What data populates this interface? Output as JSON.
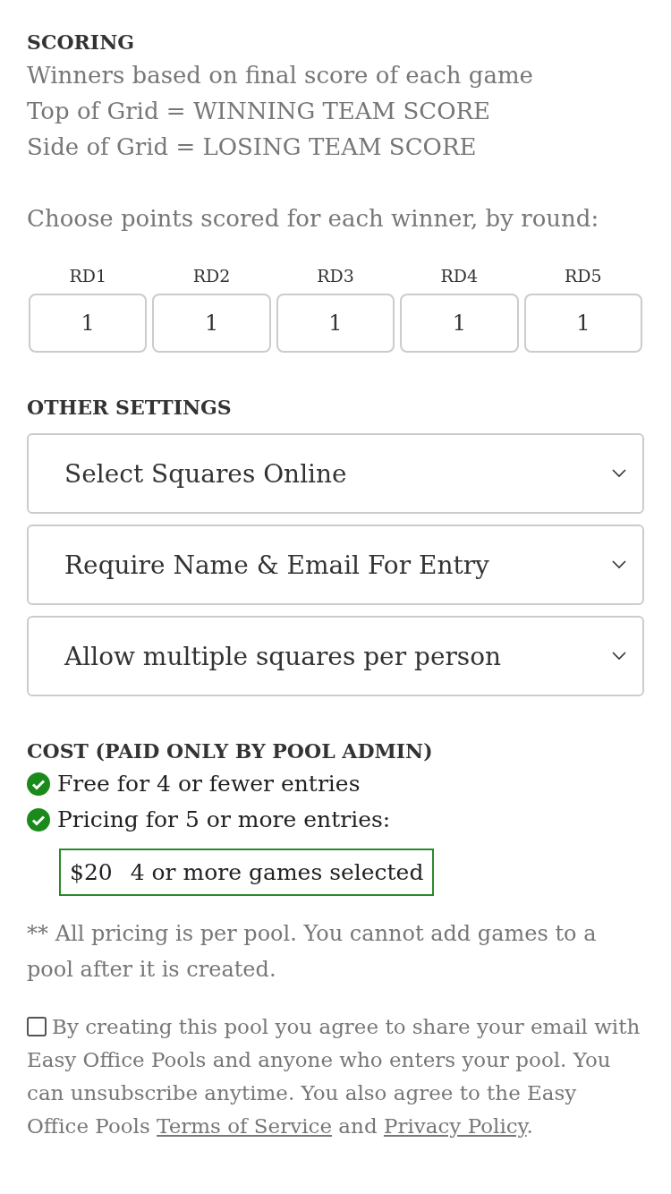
{
  "scoring": {
    "heading": "SCORING",
    "lines": [
      "Winners based on final score of each game",
      "Top of Grid = WINNING TEAM SCORE",
      "Side of Grid = LOSING TEAM SCORE"
    ]
  },
  "points_prompt": "Choose points scored for each winner, by round:",
  "rounds": [
    {
      "label": "RD1",
      "value": "1"
    },
    {
      "label": "RD2",
      "value": "1"
    },
    {
      "label": "RD3",
      "value": "1"
    },
    {
      "label": "RD4",
      "value": "1"
    },
    {
      "label": "RD5",
      "value": "1"
    }
  ],
  "other_settings": {
    "heading": "OTHER SETTINGS",
    "selects": [
      {
        "value": "Select Squares Online"
      },
      {
        "value": "Require Name & Email For Entry"
      },
      {
        "value": "Allow multiple squares per person"
      }
    ]
  },
  "cost": {
    "heading": "COST (PAID ONLY BY POOL ADMIN)",
    "items": [
      "Free for 4 or fewer entries",
      "Pricing for 5 or more entries:"
    ],
    "price": {
      "amount": "$20",
      "description": "4 or more games selected"
    }
  },
  "note": "** All pricing is per pool. You cannot add games to a pool after it is created.",
  "agreement": {
    "checked": false,
    "parts": [
      {
        "kind": "text",
        "text": "By creating this pool you agree to share your email with Easy Office Pools and anyone who enters your pool. You can unsubscribe anytime. You also agree to the Easy Office Pools "
      },
      {
        "kind": "link",
        "text": "Terms of Service"
      },
      {
        "kind": "text",
        "text": " and "
      },
      {
        "kind": "link",
        "text": "Privacy Policy"
      },
      {
        "kind": "text",
        "text": "."
      }
    ]
  }
}
